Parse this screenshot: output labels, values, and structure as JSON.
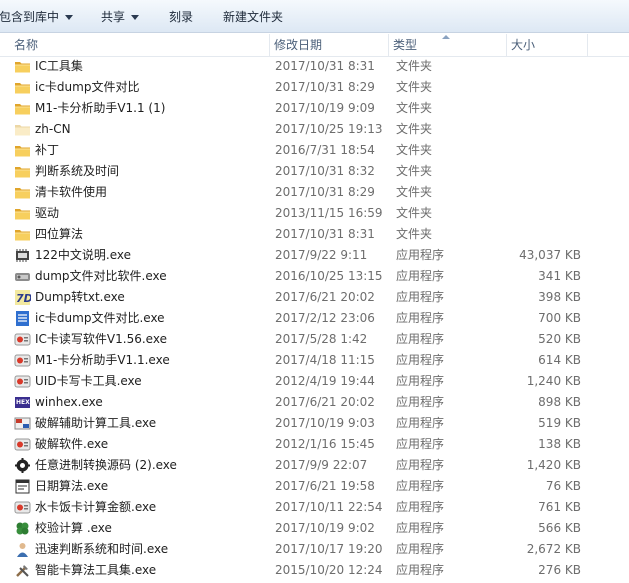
{
  "toolbar": {
    "include_library": "包含到库中",
    "share": "共享",
    "burn": "刻录",
    "new_folder": "新建文件夹"
  },
  "columns": {
    "name": "名称",
    "date": "修改日期",
    "type": "类型",
    "size": "大小"
  },
  "rows": [
    {
      "name": "IC工具集",
      "date": "2017/10/31 8:31",
      "type": "文件夹",
      "size": "",
      "icon": "folder-icon"
    },
    {
      "name": "ic卡dump文件对比",
      "date": "2017/10/31 8:29",
      "type": "文件夹",
      "size": "",
      "icon": "folder-icon"
    },
    {
      "name": "M1-卡分析助手V1.1 (1)",
      "date": "2017/10/19 9:09",
      "type": "文件夹",
      "size": "",
      "icon": "folder-icon"
    },
    {
      "name": "zh-CN",
      "date": "2017/10/25 19:13",
      "type": "文件夹",
      "size": "",
      "icon": "folder-light-icon"
    },
    {
      "name": "补丁",
      "date": "2016/7/31 18:54",
      "type": "文件夹",
      "size": "",
      "icon": "folder-icon"
    },
    {
      "name": "判断系统及时间",
      "date": "2017/10/31 8:32",
      "type": "文件夹",
      "size": "",
      "icon": "folder-icon"
    },
    {
      "name": "清卡软件使用",
      "date": "2017/10/31 8:29",
      "type": "文件夹",
      "size": "",
      "icon": "folder-icon"
    },
    {
      "name": "驱动",
      "date": "2013/11/15 16:59",
      "type": "文件夹",
      "size": "",
      "icon": "folder-icon"
    },
    {
      "name": "四位算法",
      "date": "2017/10/31 8:31",
      "type": "文件夹",
      "size": "",
      "icon": "folder-icon"
    },
    {
      "name": "122中文说明.exe",
      "date": "2017/9/22 9:11",
      "type": "应用程序",
      "size": "43,037 KB",
      "icon": "chip-app-icon"
    },
    {
      "name": "dump文件对比软件.exe",
      "date": "2016/10/25 13:15",
      "type": "应用程序",
      "size": "341 KB",
      "icon": "compare-app-icon"
    },
    {
      "name": "Dump转txt.exe",
      "date": "2017/6/21 20:02",
      "type": "应用程序",
      "size": "398 KB",
      "icon": "convert-app-icon"
    },
    {
      "name": "ic卡dump文件对比.exe",
      "date": "2017/2/12 23:06",
      "type": "应用程序",
      "size": "700 KB",
      "icon": "document-app-icon"
    },
    {
      "name": "IC卡读写软件V1.56.exe",
      "date": "2017/5/28 1:42",
      "type": "应用程序",
      "size": "520 KB",
      "icon": "card-reader-app-icon"
    },
    {
      "name": "M1-卡分析助手V1.1.exe",
      "date": "2017/4/18 11:15",
      "type": "应用程序",
      "size": "614 KB",
      "icon": "card-reader-app-icon"
    },
    {
      "name": "UID卡写卡工具.exe",
      "date": "2012/4/19 19:44",
      "type": "应用程序",
      "size": "1,240 KB",
      "icon": "card-reader-app-icon"
    },
    {
      "name": "winhex.exe",
      "date": "2017/6/21 20:02",
      "type": "应用程序",
      "size": "898 KB",
      "icon": "hex-app-icon"
    },
    {
      "name": "破解辅助计算工具.exe",
      "date": "2017/10/19 9:03",
      "type": "应用程序",
      "size": "519 KB",
      "icon": "calculator-app-icon"
    },
    {
      "name": "破解软件.exe",
      "date": "2012/1/16 15:45",
      "type": "应用程序",
      "size": "138 KB",
      "icon": "card-reader-app-icon"
    },
    {
      "name": "任意进制转换源码 (2).exe",
      "date": "2017/9/9 22:07",
      "type": "应用程序",
      "size": "1,420 KB",
      "icon": "gear-app-icon"
    },
    {
      "name": "日期算法.exe",
      "date": "2017/6/21 19:58",
      "type": "应用程序",
      "size": "76 KB",
      "icon": "window-app-icon"
    },
    {
      "name": "水卡饭卡计算金额.exe",
      "date": "2017/10/11 22:54",
      "type": "应用程序",
      "size": "761 KB",
      "icon": "card-reader-app-icon"
    },
    {
      "name": "校验计算 .exe",
      "date": "2017/10/19 9:02",
      "type": "应用程序",
      "size": "566 KB",
      "icon": "clover-app-icon"
    },
    {
      "name": "迅速判断系统和时间.exe",
      "date": "2017/10/17 19:20",
      "type": "应用程序",
      "size": "2,672 KB",
      "icon": "person-app-icon"
    },
    {
      "name": "智能卡算法工具集.exe",
      "date": "2015/10/20 12:24",
      "type": "应用程序",
      "size": "276 KB",
      "icon": "tools-app-icon"
    }
  ]
}
